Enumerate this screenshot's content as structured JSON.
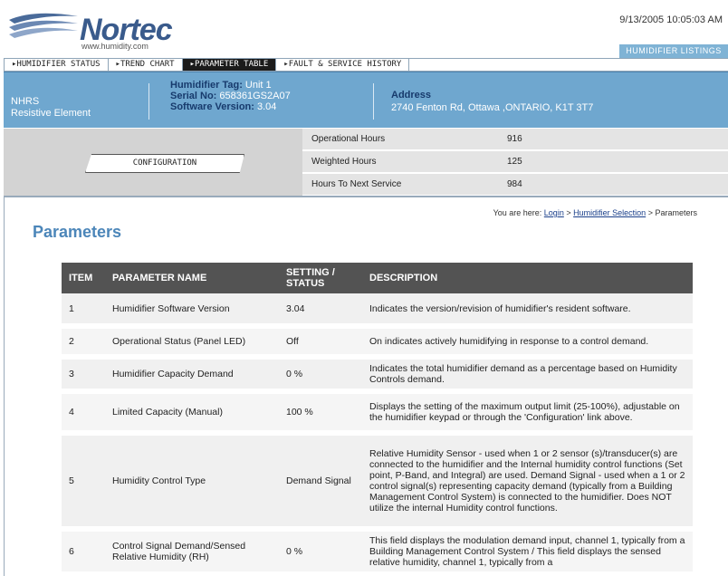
{
  "brand": {
    "name": "Nortec",
    "url": "www.humidity.com"
  },
  "datetime": "9/13/2005 10:05:03 AM",
  "listings_tab": "HUMIDIFIER LISTINGS",
  "nav": [
    {
      "label": "▸HUMIDIFIER STATUS",
      "active": false
    },
    {
      "label": "▸TREND CHART",
      "active": false
    },
    {
      "label": "▸PARAMETER TABLE",
      "active": true
    },
    {
      "label": "▸FAULT & SERVICE HISTORY",
      "active": false
    }
  ],
  "info": {
    "model_line1": "NHRS",
    "model_line2": "Resistive Element",
    "tag_label": "Humidifier Tag:",
    "tag_value": "Unit 1",
    "serial_label": "Serial No:",
    "serial_value": "658361GS2A07",
    "software_label": "Software Version:",
    "software_value": "3.04",
    "address_label": "Address",
    "address_value": "2740 Fenton Rd, Ottawa ,ONTARIO, K1T 3T7"
  },
  "config_button": "CONFIGURATION",
  "hours": [
    {
      "label": "Operational Hours",
      "value": "916"
    },
    {
      "label": "Weighted Hours",
      "value": "125"
    },
    {
      "label": "Hours To Next Service",
      "value": "984"
    }
  ],
  "breadcrumb": {
    "prefix": "You are here:",
    "login": "Login",
    "sep1": ">",
    "selection": "Humidifier Selection",
    "sep2": ">",
    "current": "Parameters"
  },
  "page_title": "Parameters",
  "table": {
    "headers": [
      "ITEM",
      "PARAMETER NAME",
      "SETTING / STATUS",
      "DESCRIPTION"
    ],
    "rows": [
      {
        "item": "1",
        "name": "Humidifier Software Version",
        "setting": "3.04",
        "desc": "Indicates the version/revision of humidifier's resident software."
      },
      {
        "item": "2",
        "name": "Operational Status (Panel LED)",
        "setting": "Off",
        "desc": "On indicates actively humidifying in response to a control demand."
      },
      {
        "item": "3",
        "name": "Humidifier Capacity Demand",
        "setting": "0 %",
        "desc": "Indicates the total humidifier demand as a percentage based on Humidity Controls demand."
      },
      {
        "item": "4",
        "name": "Limited Capacity (Manual)",
        "setting": "100 %",
        "desc": "Displays the setting of the maximum output limit (25-100%), adjustable on the humidifier keypad or through the 'Configuration' link above."
      },
      {
        "item": "5",
        "name": "Humidity Control Type",
        "setting": "Demand Signal",
        "desc": "Relative Humidity Sensor - used when 1 or 2 sensor (s)/transducer(s) are connected to the humidifier and the Internal humidity control functions (Set point, P-Band, and Integral) are used. Demand Signal - used when a 1 or 2 control signal(s) representing capacity demand (typically from a Building Management Control System) is connected to the humidifier. Does NOT utilize the internal Humidity control functions."
      },
      {
        "item": "6",
        "name": "Control Signal Demand/Sensed Relative Humidity (RH)",
        "setting": "0 %",
        "desc": "This field displays the modulation demand input, channel 1, typically from a Building Management Control System / This field displays the sensed relative humidity, channel 1, typically from a"
      }
    ]
  }
}
